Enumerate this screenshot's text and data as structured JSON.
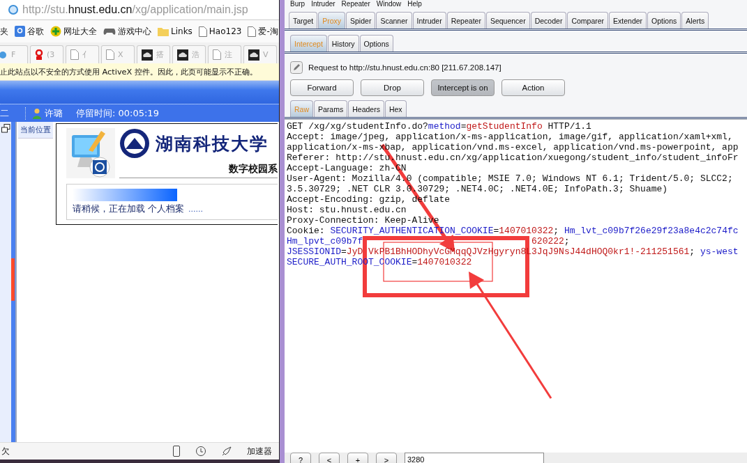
{
  "browser": {
    "address": {
      "prefix": "http://stu.",
      "host": "hnust.edu.cn",
      "path": "/xg/application/main.jsp"
    },
    "favorites": [
      {
        "label": "夹",
        "kind": "plain"
      },
      {
        "label": "谷歌",
        "kind": "google"
      },
      {
        "label": "网址大全",
        "kind": "plus"
      },
      {
        "label": "游戏中心",
        "kind": "gamepad"
      },
      {
        "label": "Links",
        "kind": "folder"
      },
      {
        "label": "Hao123",
        "kind": "page"
      },
      {
        "label": "爱-淘",
        "kind": "page"
      }
    ],
    "tabs": [
      {
        "kind": "globe",
        "label": "F"
      },
      {
        "kind": "logo",
        "label": "(3"
      },
      {
        "kind": "page",
        "label": "亻"
      },
      {
        "kind": "page",
        "label": "X"
      },
      {
        "kind": "cloud",
        "label": "搭"
      },
      {
        "kind": "cloud",
        "label": "浩"
      },
      {
        "kind": "page",
        "label": "注"
      },
      {
        "kind": "cloud",
        "label": "V"
      }
    ],
    "info_bar": "止此站点以不安全的方式使用 ActiveX 控件。因此，此页可能显示不正确。",
    "user_bar": {
      "section": "二",
      "user": "许璐",
      "time": "停留时间: 00:05:19"
    },
    "breadcrumb": "当前位置",
    "loading_dialog": {
      "title": "湖南科技大学",
      "subtitle": "数字校园系",
      "message": "请稍候，正在加载 个人档案",
      "dots": "......"
    },
    "status_bar": {
      "text": "欠",
      "accelerator": "加速器"
    }
  },
  "burp": {
    "menu": [
      "Burp",
      "Intruder",
      "Repeater",
      "Window",
      "Help"
    ],
    "tabs": [
      {
        "label": "Target",
        "selected": false
      },
      {
        "label": "Proxy",
        "selected": true
      },
      {
        "label": "Spider",
        "selected": false
      },
      {
        "label": "Scanner",
        "selected": false
      },
      {
        "label": "Intruder",
        "selected": false
      },
      {
        "label": "Repeater",
        "selected": false
      },
      {
        "label": "Sequencer",
        "selected": false
      },
      {
        "label": "Decoder",
        "selected": false
      },
      {
        "label": "Comparer",
        "selected": false
      },
      {
        "label": "Extender",
        "selected": false
      },
      {
        "label": "Options",
        "selected": false
      },
      {
        "label": "Alerts",
        "selected": false
      }
    ],
    "subtabs": [
      {
        "label": "Intercept",
        "selected": true
      },
      {
        "label": "History",
        "selected": false
      },
      {
        "label": "Options",
        "selected": false
      }
    ],
    "request_info": "Request to http://stu.hnust.edu.cn:80  [211.67.208.147]",
    "buttons": [
      {
        "label": "Forward",
        "pressed": false
      },
      {
        "label": "Drop",
        "pressed": false
      },
      {
        "label": "Intercept is on",
        "pressed": true
      },
      {
        "label": "Action",
        "pressed": false
      }
    ],
    "editor_tabs": [
      {
        "label": "Raw",
        "selected": true
      },
      {
        "label": "Params",
        "selected": false
      },
      {
        "label": "Headers",
        "selected": false
      },
      {
        "label": "Hex",
        "selected": false
      }
    ],
    "request_lines": [
      [
        {
          "t": "GET /xg/xg/studentInfo.do?",
          "kind": "plain"
        },
        {
          "t": "method",
          "kind": "name"
        },
        {
          "t": "=",
          "kind": "plain"
        },
        {
          "t": "getStudentInfo",
          "kind": "value"
        },
        {
          "t": " HTTP/1.1",
          "kind": "plain"
        }
      ],
      [
        {
          "t": "Accept: image/jpeg, application/x-ms-application, image/gif, application/xaml+xml,",
          "kind": "plain"
        }
      ],
      [
        {
          "t": "application/x-ms-xbap, application/vnd.ms-excel, application/vnd.ms-powerpoint, app",
          "kind": "plain"
        }
      ],
      [
        {
          "t": "Referer: http://stu.hnust.edu.cn/xg/application/xuegong/student_info/student_infoFr",
          "kind": "plain"
        }
      ],
      [
        {
          "t": "Accept-Language: zh-CN",
          "kind": "plain"
        }
      ],
      [
        {
          "t": "User-Agent: Mozilla/4.0 (compatible; MSIE 7.0; Windows NT 6.1; Trident/5.0; SLCC2;",
          "kind": "plain"
        }
      ],
      [
        {
          "t": "3.5.30729; .NET CLR 3.0.30729; .NET4.0C; .NET4.0E; InfoPath.3; Shuame)",
          "kind": "plain"
        }
      ],
      [
        {
          "t": "Accept-Encoding: gzip, deflate",
          "kind": "plain"
        }
      ],
      [
        {
          "t": "Host: stu.hnust.edu.cn",
          "kind": "plain"
        }
      ],
      [
        {
          "t": "Proxy-Connection: Keep-Alive",
          "kind": "plain"
        }
      ],
      [
        {
          "t": "Cookie: ",
          "kind": "plain"
        },
        {
          "t": "SECURITY_AUTHENTICATION_COOKIE",
          "kind": "name"
        },
        {
          "t": "=",
          "kind": "plain"
        },
        {
          "t": "1407010322",
          "kind": "value"
        },
        {
          "t": "; ",
          "kind": "plain"
        },
        {
          "t": "Hm_lvt_c09b7f26e29f23a8e4c2c74fc",
          "kind": "name"
        }
      ],
      [
        {
          "t": "Hm_lpvt_c09b7f",
          "kind": "name"
        },
        {
          "t": "620222",
          "kind": "covered_value"
        },
        {
          "t": ";",
          "kind": "plain"
        }
      ],
      [
        {
          "t": "JSESSIONID",
          "kind": "name"
        },
        {
          "t": "=",
          "kind": "plain"
        },
        {
          "t": "JyD VkPB1BhHODhyVcGMqqQJVzHgyryn8L3JqJ9NsJ44dHOQ0kr1!-211251561",
          "kind": "value"
        },
        {
          "t": "; ",
          "kind": "plain"
        },
        {
          "t": "ys-west",
          "kind": "name"
        }
      ],
      [
        {
          "t": "SECURE_AUTH_ROOT_COOKIE",
          "kind": "name"
        },
        {
          "t": "=",
          "kind": "plain"
        },
        {
          "t": "1407010322",
          "kind": "value"
        }
      ]
    ],
    "footer": {
      "buttons": [
        "?",
        "<",
        "+",
        ">"
      ],
      "search_value": "3280"
    }
  }
}
